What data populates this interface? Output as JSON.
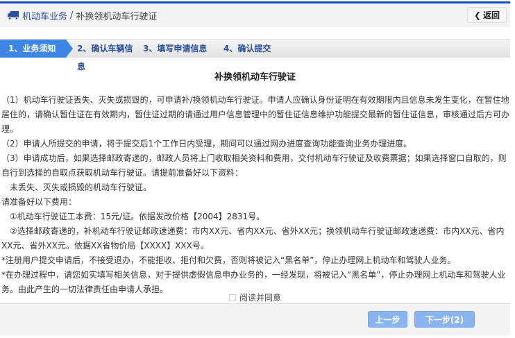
{
  "header": {
    "section": "机动车业务",
    "separator": "/",
    "page": "补换领机动车行驶证",
    "back_label": "返回"
  },
  "steps": [
    {
      "label": "1、业务须知"
    },
    {
      "label": "2、确认车辆信息"
    },
    {
      "label": "3、填写申请信息"
    },
    {
      "label": "4、确认提交"
    }
  ],
  "title": "补换领机动车行驶证",
  "paragraphs": [
    "（1）机动车行驶证丢失、灭失或损毁的，可申请补/换领机动车行驶证。申请人应确认身份证明在有效期限内且信息未发生变化，在暂住地居住的，请确认暂住证在有效期内，暂住证过期的请通过用户信息管理中的暂住证信息维护功能提交最新的暂住证信息，审核通过后方可办理。",
    "（2）申请人所提交的申请，将于提交后1个工作日内受理，期间可以通过网办进度查询功能查询业务办理进度。",
    "（3）申请成功后，如果选择邮政寄递的，邮政人员将上门收取相关资料和费用，交付机动车行驶证及收费票据；如果选择窗口自取的，则自行到选择的自取点获取机动车行驶证。请提前准备好以下资料：",
    "　未丢失、灭失或损毁的机动车行驶证。",
    "请准备好以下费用：",
    "　①机动车行驶证工本费：15元/证。依据发改价格【2004】2831号。",
    "　②选择邮政寄递的，补机动车行驶证邮政速递费：市内XX元、省内XX元、省外XX元；换领机动车行驶证邮政速递费：市内XX元、省内XX元、省外XX元。依据XX省物价局【XXXX】XXX号。",
    "*注册用户提交申请后，不接受退办，不能拒收、拒付和欠费，否则将被记入“黑名单”，停止办理网上机动车和驾驶人业务。",
    "*在办理过程中，请您如实填写相关信息，对于提供虚假信息申办业务的，一经发现，将被记入“黑名单”，停止办理网上机动车和驾驶人业务。由此产生的一切法律责任由申请人承担。"
  ],
  "agree_label": "阅读并同意",
  "buttons": {
    "prev": "上一步",
    "next": "下一步(2)"
  },
  "colors": {
    "accent": "#3e86e6",
    "top_line": "#1a4fc0",
    "button": "#8ab4f0"
  }
}
